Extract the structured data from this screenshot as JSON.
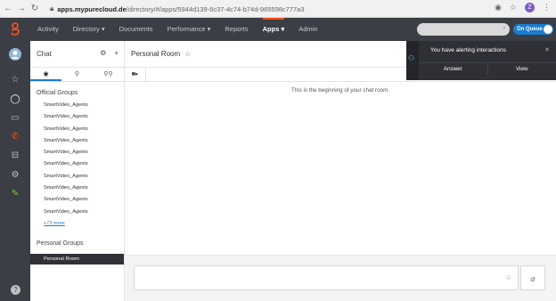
{
  "browser": {
    "url_host": "apps.mypurecloud.de",
    "url_path": "/directory/#/apps/5944d139-6c37-4c74-b74d-965598c777a3",
    "profile_initial": "Z"
  },
  "topnav": {
    "items": [
      "Activity",
      "Directory ▾",
      "Documents",
      "Performance ▾",
      "Reports",
      "Apps ▾",
      "Admin"
    ],
    "active_index": 5,
    "status_label": "On Queue"
  },
  "chat": {
    "title": "Chat",
    "tab_icons": [
      "chat-bubble-icon",
      "person-icon",
      "people-icon"
    ],
    "official_groups_title": "Official Groups",
    "official_groups": [
      "SmartVideo_Agents",
      "SmartVideo_Agents",
      "SmartVideo_Agents",
      "SmartVideo_Agents",
      "SmartVideo_Agents",
      "SmartVideo_Agents",
      "SmartVideo_Agents",
      "SmartVideo_Agents",
      "SmartVideo_Agents",
      "SmartVideo_Agents"
    ],
    "more_link": "+73 more",
    "personal_groups_title": "Personal Groups",
    "personal_room_item": "Personal Room"
  },
  "room": {
    "title": "Personal Room",
    "beginning_text": "This is the beginning of your chat room."
  },
  "alert": {
    "text": "You have alerting interactions",
    "answer_label": "Answer",
    "view_label": "View"
  },
  "colors": {
    "nav_bg": "#3b3e45",
    "accent": "#ff4f1f",
    "queue_blue": "#1b7dd0"
  }
}
